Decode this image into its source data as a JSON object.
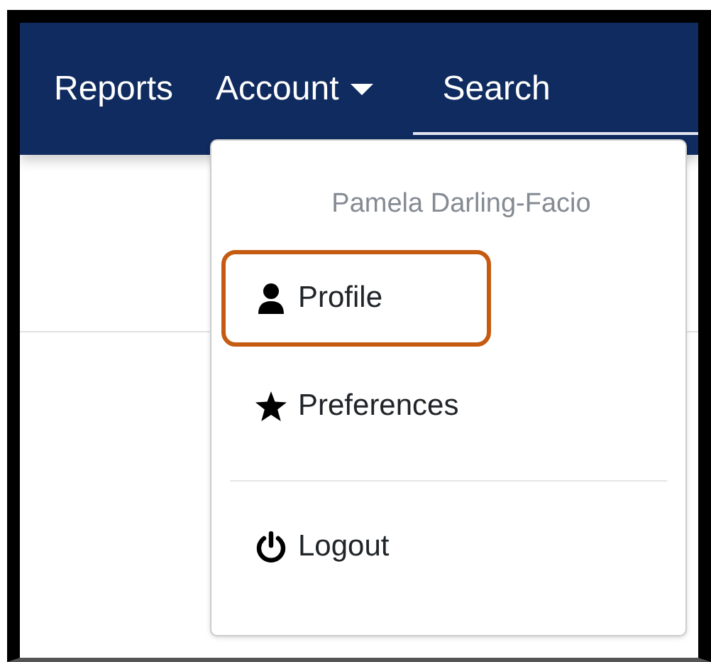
{
  "navbar": {
    "items": [
      {
        "label": "Reports",
        "kind": "link"
      },
      {
        "label": "Account",
        "kind": "dropdown",
        "expanded": true
      }
    ],
    "search": {
      "placeholder": "Search"
    }
  },
  "account_menu": {
    "user_name": "Pamela Darling-Facio",
    "items": [
      {
        "kind": "item",
        "label": "Profile",
        "highlighted": true
      },
      {
        "kind": "item",
        "label": "Preferences",
        "highlighted": false
      },
      {
        "kind": "divider"
      },
      {
        "kind": "item",
        "label": "Logout",
        "highlighted": false
      }
    ]
  }
}
